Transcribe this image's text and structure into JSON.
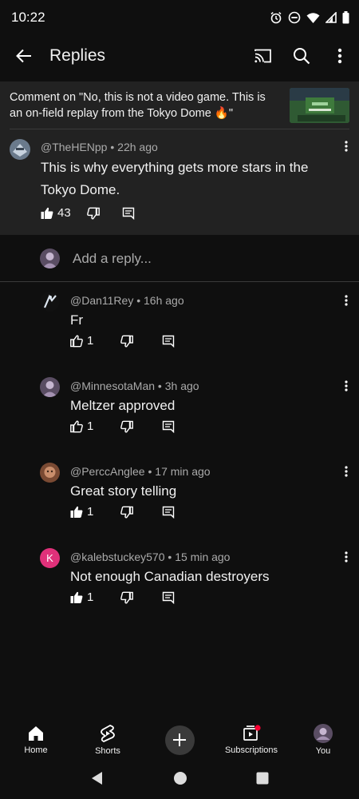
{
  "status": {
    "time": "10:22"
  },
  "header": {
    "title": "Replies"
  },
  "context": {
    "text": "Comment on \"No, this is not a video game. This is an on-field replay from the Tokyo Dome 🔥\""
  },
  "parent": {
    "author": "@TheHENpp",
    "age": "22h ago",
    "body": "This is why everything gets more stars in the Tokyo Dome.",
    "likes": "43"
  },
  "reply_input": {
    "placeholder": "Add a reply..."
  },
  "replies": [
    {
      "author": "@Dan11Rey",
      "age": "16h ago",
      "text": "Fr",
      "likes": "1",
      "liked": false
    },
    {
      "author": "@MinnesotaMan",
      "age": "3h ago",
      "text": "Meltzer approved",
      "likes": "1",
      "liked": false
    },
    {
      "author": "@PerccAnglee",
      "age": "17 min ago",
      "text": "Great story telling",
      "likes": "1",
      "liked": true
    },
    {
      "author": "@kalebstuckey570",
      "age": "15 min ago",
      "text": "Not enough Canadian destroyers",
      "likes": "1",
      "liked": true,
      "avatar_letter": "K",
      "avatar_color": "#e0317a"
    }
  ],
  "nav": {
    "home": "Home",
    "shorts": "Shorts",
    "subscriptions": "Subscriptions",
    "you": "You"
  },
  "colors": {
    "background": "#0f0f0f",
    "card": "#222222",
    "notification_dot": "#ff0033"
  }
}
